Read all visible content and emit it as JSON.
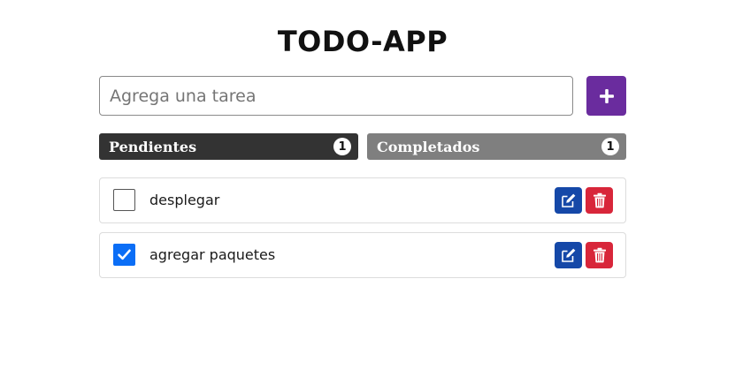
{
  "app": {
    "title": "TODO-APP"
  },
  "new_task": {
    "placeholder": "Agrega una tarea",
    "value": "",
    "add_icon": "plus-icon",
    "add_button_color": "#6a2c9e"
  },
  "tabs": [
    {
      "label": "Pendientes",
      "count": "1",
      "color": "#333333"
    },
    {
      "label": "Completados",
      "count": "1",
      "color": "#7f7f7f"
    }
  ],
  "tasks": [
    {
      "text": "desplegar",
      "checked": false,
      "edit_icon": "edit-icon",
      "delete_icon": "trash-icon"
    },
    {
      "text": "agregar paquetes",
      "checked": true,
      "edit_icon": "edit-icon",
      "delete_icon": "trash-icon"
    }
  ],
  "colors": {
    "edit": "#1548a8",
    "delete": "#d8263a",
    "checkbox_checked": "#0b6ef6"
  }
}
